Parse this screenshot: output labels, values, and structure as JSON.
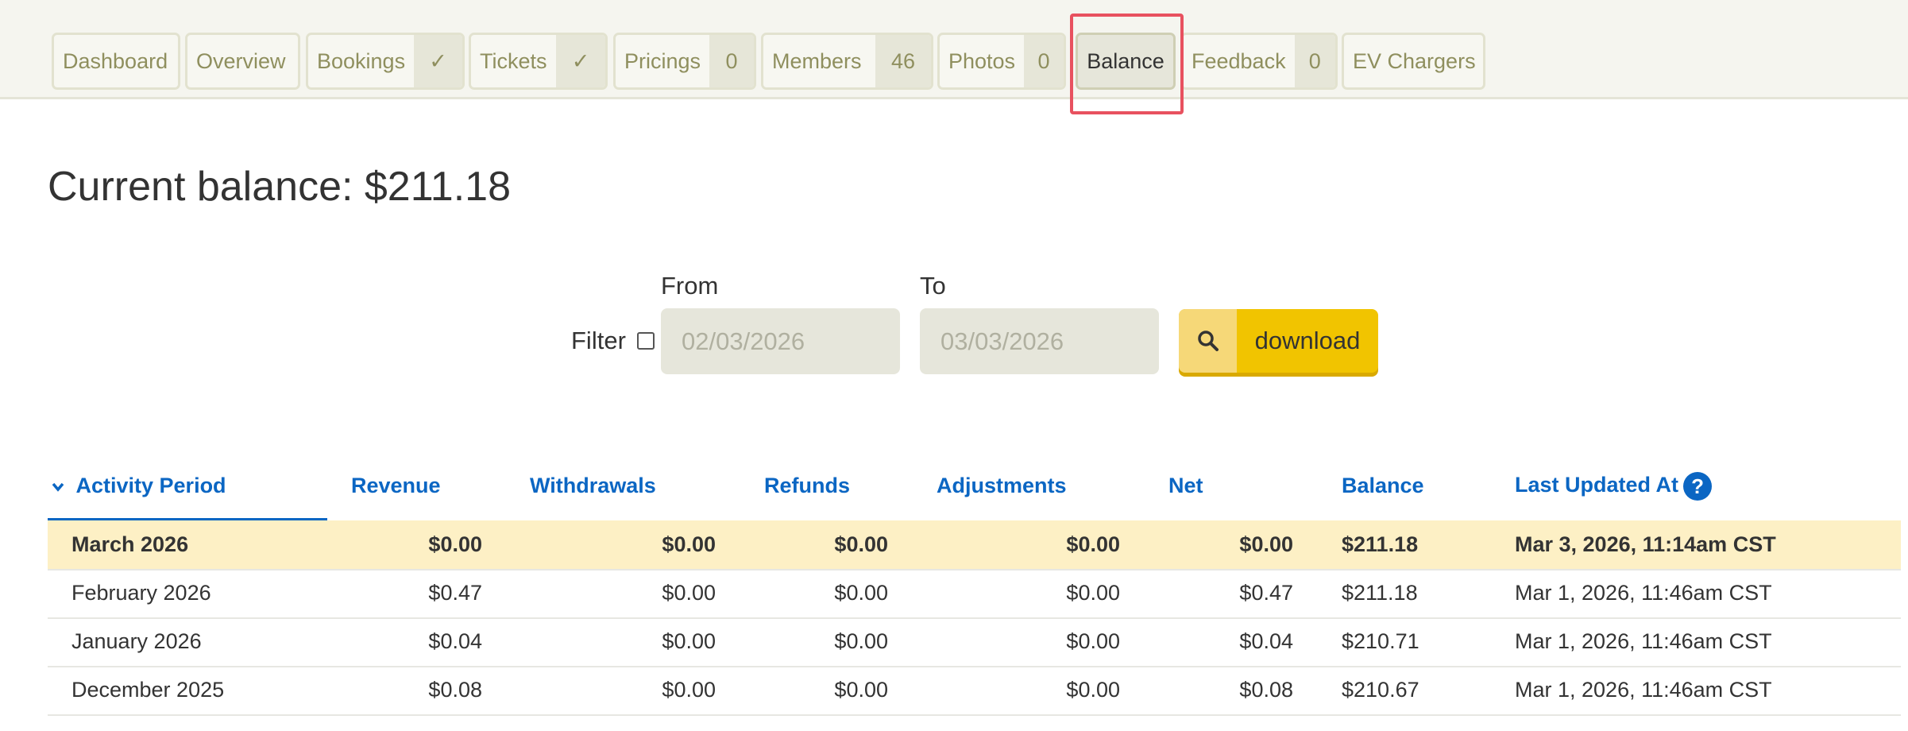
{
  "tabs": [
    {
      "label": "Dashboard",
      "badge": ""
    },
    {
      "label": "Overview",
      "badge": ""
    },
    {
      "label": "Bookings",
      "badge": "✓"
    },
    {
      "label": "Tickets",
      "badge": "✓"
    },
    {
      "label": "Pricings",
      "badge": "0"
    },
    {
      "label": "Members",
      "badge": "46"
    },
    {
      "label": "Photos",
      "badge": "0"
    },
    {
      "label": "Balance",
      "badge": "",
      "active": true
    },
    {
      "label": "Feedback",
      "badge": "0"
    },
    {
      "label": "EV Chargers",
      "badge": ""
    }
  ],
  "page": {
    "title": "Current balance: $211.18"
  },
  "filter": {
    "label": "Filter",
    "from_label": "From",
    "to_label": "To",
    "from_placeholder": "02/03/2026",
    "to_placeholder": "03/03/2026",
    "download_label": "download",
    "download_icon": "search-icon"
  },
  "table": {
    "columns": [
      "Activity Period",
      "Revenue",
      "Withdrawals",
      "Refunds",
      "Adjustments",
      "Net",
      "Balance",
      "Last Updated At"
    ],
    "sort_icon": "chevron-down-icon",
    "help_icon": "?",
    "rows": [
      [
        "March 2026",
        "$0.00",
        "$0.00",
        "$0.00",
        "$0.00",
        "$0.00",
        "$211.18",
        "Mar 3, 2026, 11:14am CST"
      ],
      [
        "February 2026",
        "$0.47",
        "$0.00",
        "$0.00",
        "$0.00",
        "$0.47",
        "$211.18",
        "Mar 1, 2026, 11:46am CST"
      ],
      [
        "January 2026",
        "$0.04",
        "$0.00",
        "$0.00",
        "$0.00",
        "$0.04",
        "$210.71",
        "Mar 1, 2026, 11:46am CST"
      ],
      [
        "December 2025",
        "$0.08",
        "$0.00",
        "$0.00",
        "$0.00",
        "$0.08",
        "$210.67",
        "Mar 1, 2026, 11:46am CST"
      ]
    ]
  },
  "colors": {
    "accent": "#0b66c3",
    "button": "#f1c400",
    "current_row": "#fdf0c5",
    "highlight": "#e8515f"
  }
}
